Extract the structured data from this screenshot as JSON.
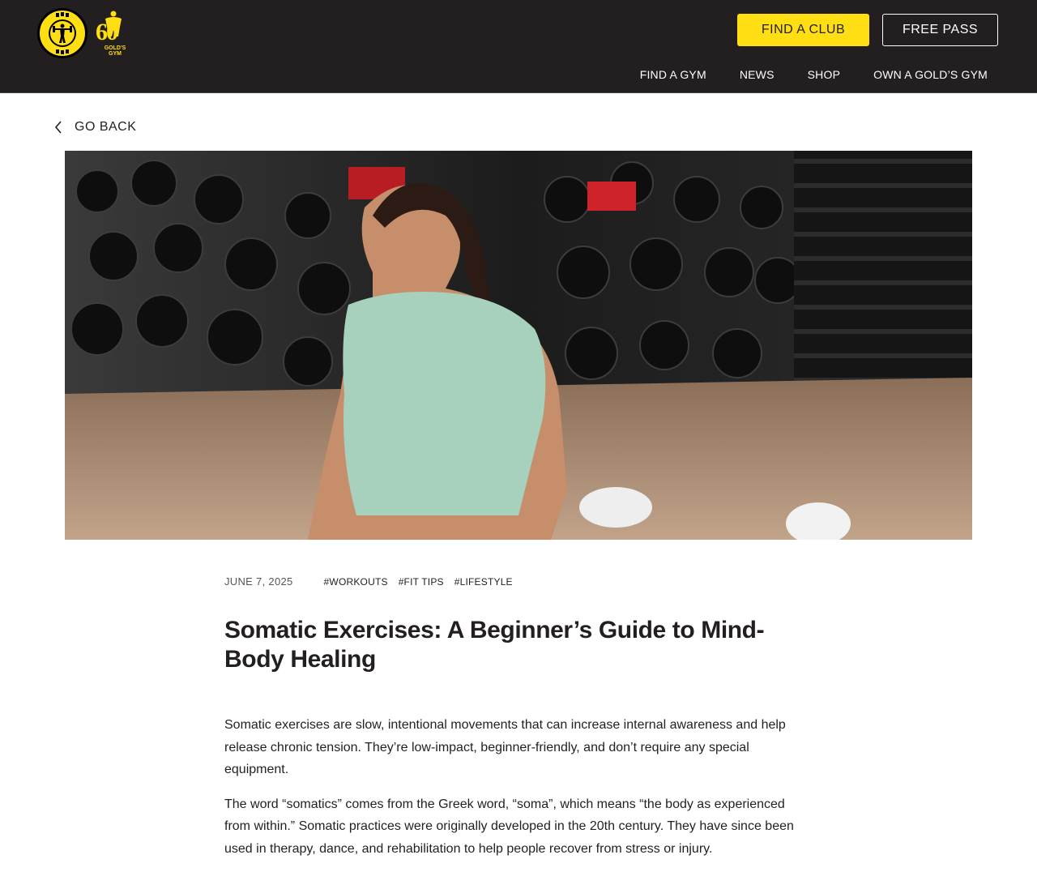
{
  "header": {
    "logo_alt": "Gold's Gym",
    "logo_60_text": "60",
    "logo_60_sub": "GOLD'S GYM",
    "find_club_label": "FIND A CLUB",
    "free_pass_label": "FREE PASS",
    "nav": [
      {
        "label": "FIND A GYM"
      },
      {
        "label": "NEWS"
      },
      {
        "label": "SHOP"
      },
      {
        "label": "OWN A GOLD’S GYM"
      }
    ]
  },
  "go_back": {
    "label": "GO BACK",
    "icon": "chevron-left-icon"
  },
  "hero": {
    "description_icon": "photo"
  },
  "article": {
    "date": "JUNE 7, 2025",
    "tags": [
      "#WORKOUTS",
      "#FIT TIPS",
      "#LIFESTYLE"
    ],
    "title": "Somatic Exercises: A Beginner’s Guide to Mind-Body Healing",
    "paragraphs": [
      "Somatic exercises are slow, intentional movements that can increase internal awareness and help release chronic tension. They’re low-impact, beginner-friendly, and don’t require any special equipment.",
      "The word “somatics” comes from the Greek word, “soma”, which means “the body as experienced from within.” Somatic practices were originally developed in the 20th century. They have since been used in therapy, dance, and rehabilitation to help people recover from stress or injury."
    ]
  },
  "colors": {
    "header_bg": "#231f20",
    "brand_yellow": "#ffde14",
    "text": "#231f20"
  }
}
